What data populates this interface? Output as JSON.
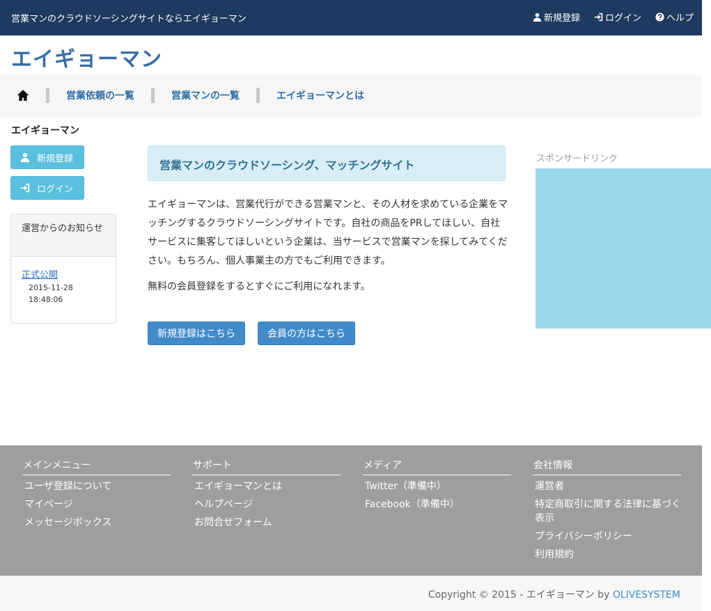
{
  "topbar": {
    "tagline": "営業マンのクラウドソーシングサイトならエイギョーマン",
    "nav": [
      {
        "label": "新規登録",
        "icon": "user-icon"
      },
      {
        "label": "ログイン",
        "icon": "login-icon"
      },
      {
        "label": "ヘルプ",
        "icon": "help-icon"
      }
    ]
  },
  "brand": "エイギョーマン",
  "menu": {
    "home_icon": "home-icon",
    "items": [
      "営業依頼の一覧",
      "営業マンの一覧",
      "エイギョーマンとは"
    ]
  },
  "breadcrumb": "エイギョーマン",
  "sidebar": {
    "register_label": "新規登録",
    "login_label": "ログイン",
    "notice": {
      "title": "運営からのお知らせ",
      "link": "正式公開",
      "date_line1": "2015-11-28",
      "date_line2": "18:48:06"
    }
  },
  "main": {
    "alert": "営業マンのクラウドソーシング、マッチングサイト",
    "para1": "エイギョーマンは、営業代行ができる営業マンと、その人材を求めている企業をマッチングするクラウドソーシングサイトです。自社の商品をPRしてほしい、自社サービスに集客してほしいという企業は、当サービスで営業マンを探してみてください。もちろん、個人事業主の方でもご利用できます。",
    "para2": "無料の会員登録をするとすぐにご利用になれます。",
    "register_button": "新規登録はこちら",
    "member_button": "会員の方はこちら"
  },
  "sponsor": {
    "label": "スポンサードリンク",
    "color": "#98d8ea"
  },
  "footer": {
    "columns": [
      {
        "title": "メインメニュー",
        "items": [
          "ユーザ登録について",
          "マイページ",
          "メッセージボックス"
        ]
      },
      {
        "title": "サポート",
        "items": [
          "エイギョーマンとは",
          "ヘルプページ",
          "お問合せフォーム"
        ]
      },
      {
        "title": "メディア",
        "items": [
          "Twitter（準備中）",
          "Facebook（準備中）"
        ]
      },
      {
        "title": "会社情報",
        "items": [
          "運営者",
          "特定商取引に関する法律に基づく表示",
          "プライバシーポリシー",
          "利用規約"
        ]
      }
    ]
  },
  "copyright": {
    "text": "Copyright © 2015 - エイギョーマン by ",
    "company": "OLIVESYSTEM"
  },
  "colors": {
    "topbar": "#1f3a60",
    "brand": "#3a6da5",
    "info_button": "#5bc0de",
    "primary_button": "#428bca",
    "footer": "#9e9e9e"
  }
}
